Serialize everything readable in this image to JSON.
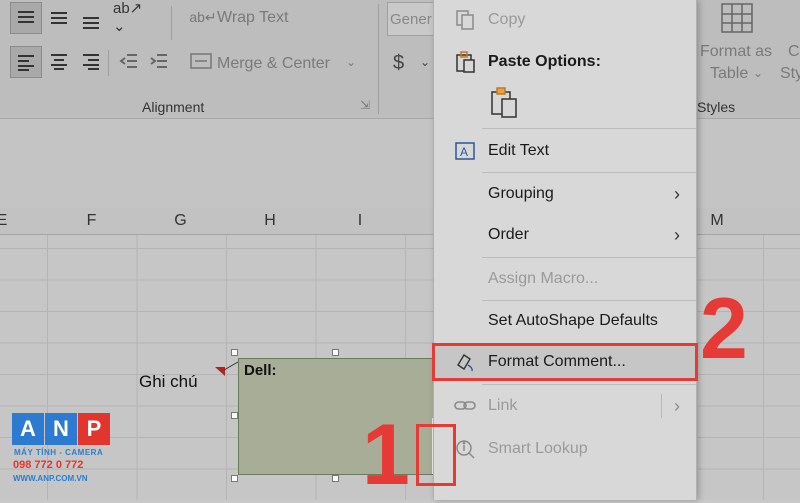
{
  "ribbon": {
    "wrap_text": "Wrap Text",
    "merge_center": "Merge & Center",
    "number_format": "Gener",
    "currency_symbol": "$",
    "group_alignment": "Alignment",
    "format_as_table_line1": "Format as",
    "format_as_table_line2": "Table",
    "cell_styles_partial_line1": "C",
    "cell_styles_partial_line2": "Sty",
    "group_styles": "Styles"
  },
  "columns": [
    "E",
    "F",
    "G",
    "H",
    "I",
    "M"
  ],
  "sheet": {
    "cell_text": "Ghi chú",
    "comment_author": "Dell:"
  },
  "context_menu": {
    "copy": "Copy",
    "paste_options": "Paste Options:",
    "edit_text": "Edit Text",
    "grouping": "Grouping",
    "order": "Order",
    "assign_macro": "Assign Macro...",
    "set_autoshape_defaults": "Set AutoShape Defaults",
    "format_comment": "Format Comment...",
    "link": "Link",
    "smart_lookup": "Smart Lookup"
  },
  "annotations": {
    "step1": "1",
    "step2": "2",
    "highlight_color": "#e53a36"
  },
  "watermark": {
    "letters": [
      "A",
      "N",
      "P"
    ],
    "line1": "MÁY TÍNH - CAMERA",
    "phone": "098 772 0 772",
    "site": "WWW.ANP.COM.VN"
  }
}
